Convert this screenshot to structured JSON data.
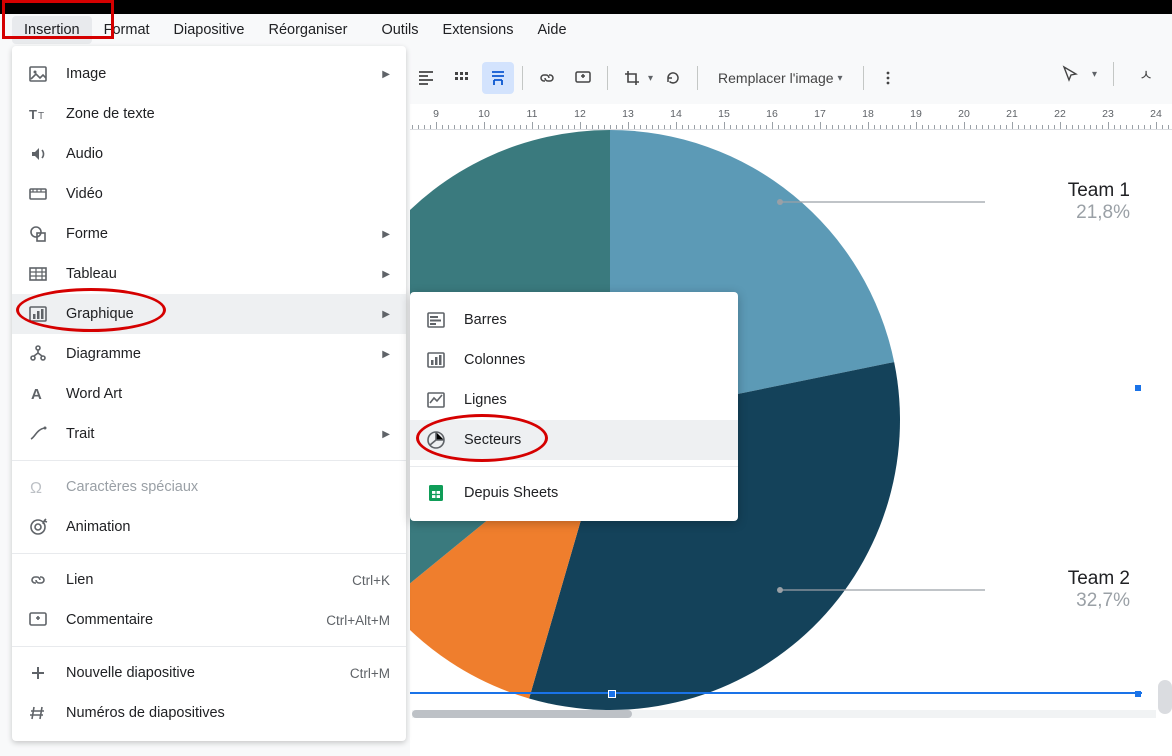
{
  "menubar": {
    "items": [
      "Insertion",
      "Format",
      "Diapositive",
      "Réorganiser",
      "Outils",
      "Extensions",
      "Aide"
    ],
    "selected": 0
  },
  "toolbar": {
    "replace_image_label": "Remplacer l'image"
  },
  "ruler": {
    "marks": [
      9,
      10,
      11,
      12,
      13,
      14,
      15,
      16,
      17,
      18,
      19,
      20,
      21,
      22,
      23,
      24
    ]
  },
  "dropdown": {
    "items": [
      {
        "label": "Image",
        "icon": "image",
        "arrow": true
      },
      {
        "label": "Zone de texte",
        "icon": "textbox"
      },
      {
        "label": "Audio",
        "icon": "audio"
      },
      {
        "label": "Vidéo",
        "icon": "video"
      },
      {
        "label": "Forme",
        "icon": "shape",
        "arrow": true
      },
      {
        "label": "Tableau",
        "icon": "table",
        "arrow": true
      },
      {
        "label": "Graphique",
        "icon": "chart",
        "arrow": true,
        "highlighted": true
      },
      {
        "label": "Diagramme",
        "icon": "diagram",
        "arrow": true
      },
      {
        "label": "Word Art",
        "icon": "wordart"
      },
      {
        "label": "Trait",
        "icon": "line",
        "arrow": true
      }
    ],
    "items2": [
      {
        "label": "Caractères spéciaux",
        "icon": "omega",
        "disabled": true
      },
      {
        "label": "Animation",
        "icon": "animation"
      }
    ],
    "items3": [
      {
        "label": "Lien",
        "icon": "link",
        "shortcut": "Ctrl+K"
      },
      {
        "label": "Commentaire",
        "icon": "comment",
        "shortcut": "Ctrl+Alt+M"
      }
    ],
    "items4": [
      {
        "label": "Nouvelle diapositive",
        "icon": "plus",
        "shortcut": "Ctrl+M"
      },
      {
        "label": "Numéros de diapositives",
        "icon": "hash"
      }
    ]
  },
  "submenu": {
    "items": [
      {
        "label": "Barres",
        "icon": "bar"
      },
      {
        "label": "Colonnes",
        "icon": "columns"
      },
      {
        "label": "Lignes",
        "icon": "linechart"
      },
      {
        "label": "Secteurs",
        "icon": "pie",
        "highlighted": true
      }
    ],
    "items2": [
      {
        "label": "Depuis Sheets",
        "icon": "sheets"
      }
    ]
  },
  "chart_data": {
    "type": "pie",
    "series": [
      {
        "name": "Team 1",
        "value": 21.8,
        "color": "#5c9ab6"
      },
      {
        "name": "Team 2",
        "value": 32.7,
        "color": "#14425a"
      },
      {
        "name": "",
        "value": 9.6,
        "color": "#ef7e2d"
      },
      {
        "name": "",
        "value": 8.1,
        "color": "#3a7a7e"
      },
      {
        "name": "",
        "value": 27.8,
        "color": "#3a7a7e"
      }
    ],
    "labels": [
      {
        "name": "Team 1",
        "pct": "21,8%"
      },
      {
        "name": "Team 2",
        "pct": "32,7%"
      }
    ]
  }
}
